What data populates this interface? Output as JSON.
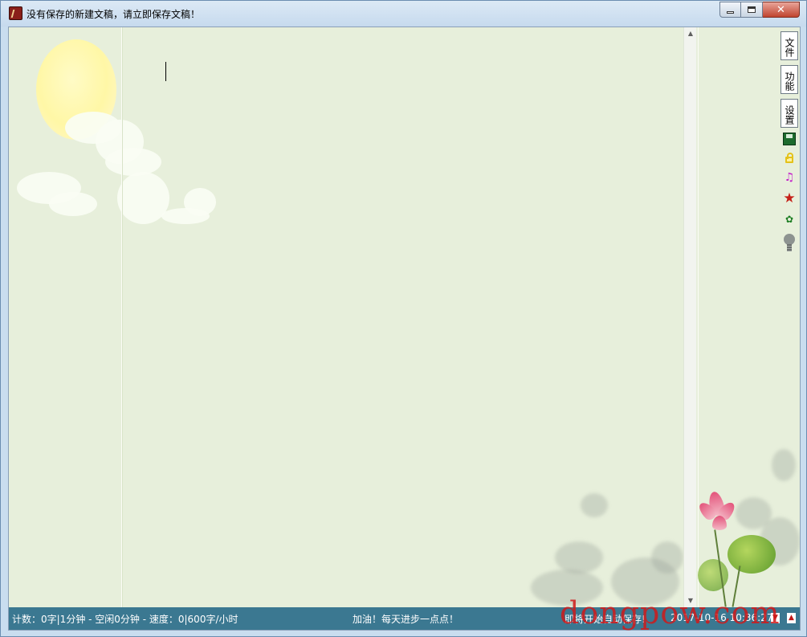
{
  "window": {
    "title": "没有保存的新建文稿，请立即保存文稿！"
  },
  "caption": {
    "minimize": "minimize-icon",
    "maximize": "maximize-icon",
    "close": "✕"
  },
  "toolbar": {
    "file_label": "文件",
    "function_label": "功能",
    "settings_label": "设置",
    "icons": [
      "save-icon",
      "lock-icon",
      "music-icon",
      "star-icon",
      "leaf-icon",
      "lightbulb-icon"
    ]
  },
  "status": {
    "stats": "计数：0字|1分钟 - 空闲0分钟 - 速度：0|600字/小时",
    "motto": "加油！每天进步一点点！",
    "autosave": "即将开始自动保存!",
    "datetime": "2017-10-16 10:36:27"
  },
  "watermark": {
    "text": "dongpow.com"
  }
}
